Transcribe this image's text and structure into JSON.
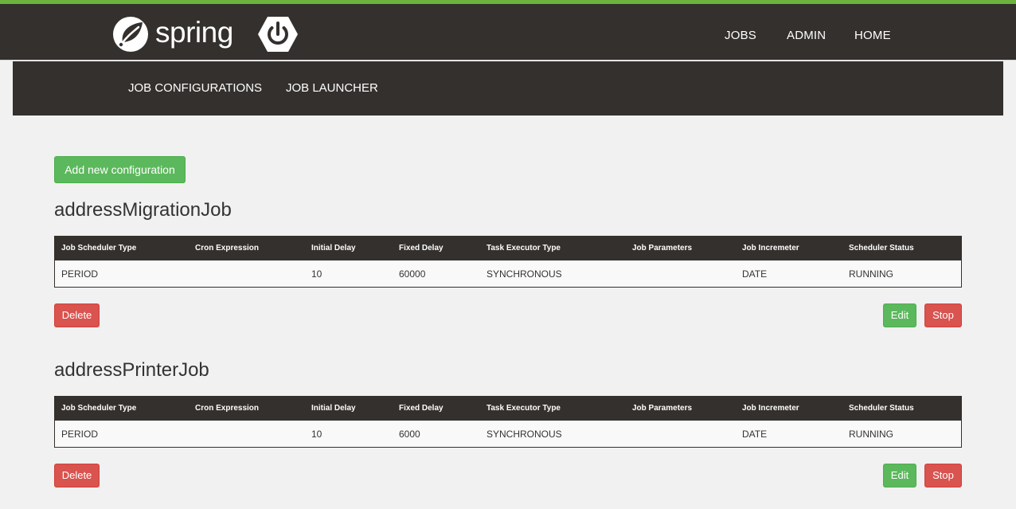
{
  "header": {
    "brand": "spring",
    "logo_icon": "spring-leaf-icon",
    "boot_icon": "spring-boot-power-icon",
    "colors": {
      "bar": "#34302d",
      "accent": "#6db33f"
    },
    "nav": [
      "JOBS",
      "ADMIN",
      "HOME"
    ]
  },
  "subnav": [
    "JOB CONFIGURATIONS",
    "JOB LAUNCHER"
  ],
  "add_button": "Add new configuration",
  "columns": [
    "Job Scheduler Type",
    "Cron Expression",
    "Initial Delay",
    "Fixed Delay",
    "Task Executor Type",
    "Job Parameters",
    "Job Incremeter",
    "Scheduler Status"
  ],
  "jobs": [
    {
      "name": "addressMigrationJob",
      "row": [
        "PERIOD",
        "",
        "10",
        "60000",
        "SYNCHRONOUS",
        "",
        "DATE",
        "RUNNING"
      ],
      "delete": "Delete",
      "edit": "Edit",
      "stop": "Stop"
    },
    {
      "name": "addressPrinterJob",
      "row": [
        "PERIOD",
        "",
        "10",
        "6000",
        "SYNCHRONOUS",
        "",
        "DATE",
        "RUNNING"
      ],
      "delete": "Delete",
      "edit": "Edit",
      "stop": "Stop"
    }
  ],
  "button_colors": {
    "green": "#5cb85c",
    "red": "#d9534f"
  }
}
